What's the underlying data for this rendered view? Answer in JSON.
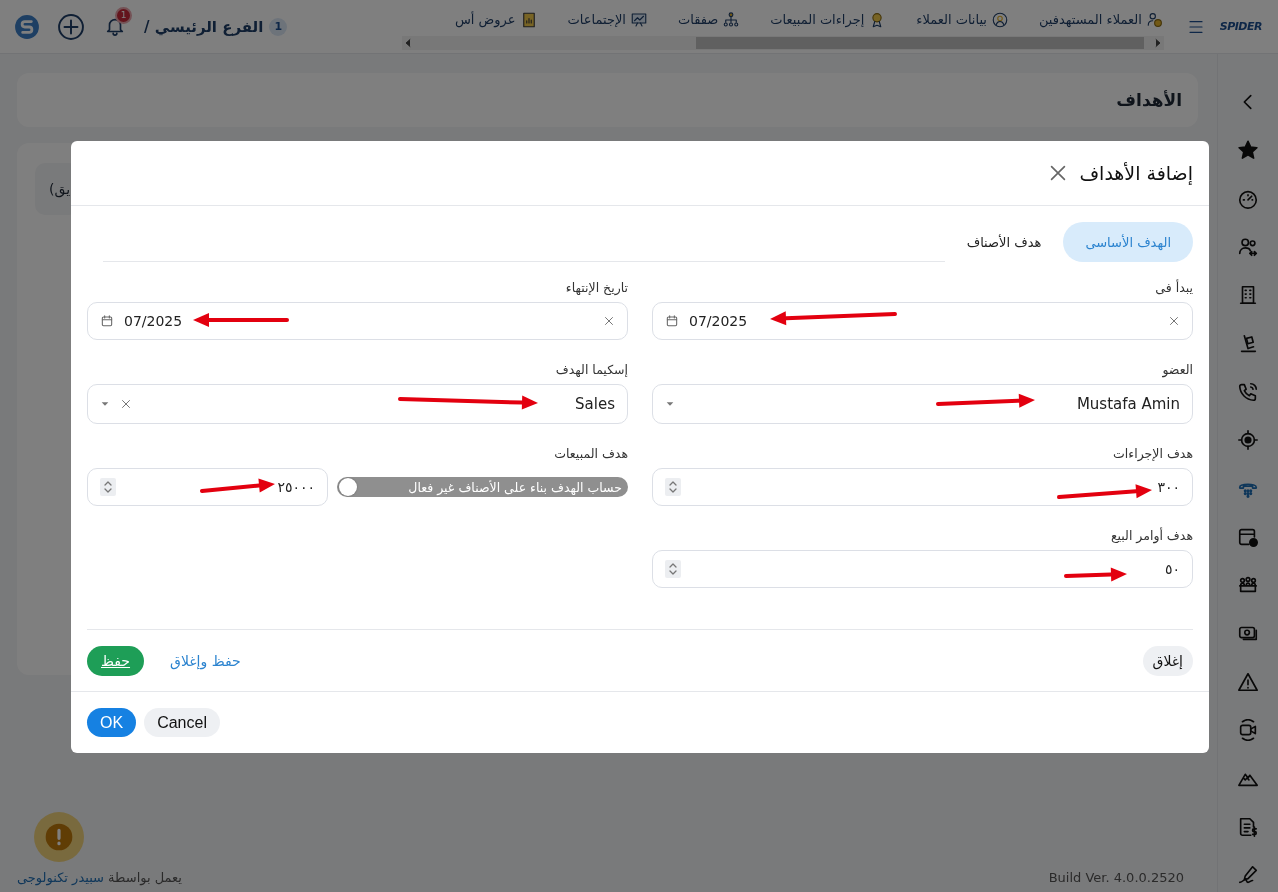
{
  "topbar": {
    "logo_text": "SPIDER",
    "nav_items": [
      {
        "label": "العملاء المستهدفين",
        "kind": "user-coin"
      },
      {
        "label": "بيانات العملاء",
        "kind": "user-target"
      },
      {
        "label": "إجراءات المبيعات",
        "kind": "medal"
      },
      {
        "label": "صفقات",
        "kind": "org"
      },
      {
        "label": "الإجتماعات",
        "kind": "board"
      },
      {
        "label": "عروض أس",
        "kind": "doc"
      }
    ],
    "branch": {
      "number": "1",
      "name": "الفرع الرئيسي /"
    },
    "notifications": {
      "count": "1"
    }
  },
  "sidebar": {
    "items": [
      {
        "kind": "back",
        "selected": false
      },
      {
        "kind": "star",
        "selected": false
      },
      {
        "kind": "gauge",
        "selected": false
      },
      {
        "kind": "users",
        "selected": false
      },
      {
        "kind": "building",
        "selected": false
      },
      {
        "kind": "dolly",
        "selected": false
      },
      {
        "kind": "phone",
        "selected": false
      },
      {
        "kind": "target",
        "selected": false
      },
      {
        "kind": "desk-phone",
        "selected": true
      },
      {
        "kind": "calendar",
        "selected": false
      },
      {
        "kind": "group",
        "selected": false
      },
      {
        "kind": "money",
        "selected": false
      },
      {
        "kind": "warning",
        "selected": false
      },
      {
        "kind": "video",
        "selected": false
      },
      {
        "kind": "mountain",
        "selected": false
      },
      {
        "kind": "invoice",
        "selected": false
      },
      {
        "kind": "signature",
        "selected": false
      }
    ]
  },
  "page": {
    "title": "الأهداف",
    "partial_text": "يق)"
  },
  "footer": {
    "build": "Build Ver. 4.0.0.2520",
    "powered_prefix": "يعمل بواسطة",
    "powered_link": "سبيدر تكنولوجى"
  },
  "modal": {
    "title": "إضافة الأهداف",
    "tabs": [
      {
        "label": "الهدف الأساسى",
        "selected": true
      },
      {
        "label": "هدف الأصناف",
        "selected": false
      }
    ],
    "fields": [
      {
        "kind": "date",
        "label": "يبدأ فى",
        "value": "07/2025",
        "clearable": true
      },
      {
        "kind": "date",
        "label": "تاريخ الإنتهاء",
        "value": "07/2025",
        "clearable": true
      },
      {
        "kind": "select",
        "label": "العضو",
        "value": "Mustafa Amin",
        "clearable": false
      },
      {
        "kind": "select",
        "label": "إسكيما الهدف",
        "value": "Sales",
        "clearable": true
      },
      {
        "kind": "number",
        "label": "هدف الإجراءات",
        "value": "٣٠٠"
      },
      {
        "kind": "number",
        "label": "هدف المبيعات",
        "value": "٢٥٠٠٠",
        "toggle": {
          "label": "حساب الهدف بناء على الأصناف غير فعال",
          "on": false
        }
      },
      {
        "kind": "number",
        "label": "هدف أوامر البيع",
        "value": "٥٠"
      }
    ],
    "actions": {
      "close": "إغلاق",
      "save_close": "حفظ وإغلاق",
      "save": "حفظ"
    },
    "dialog_buttons": {
      "ok": "OK",
      "cancel": "Cancel"
    }
  }
}
